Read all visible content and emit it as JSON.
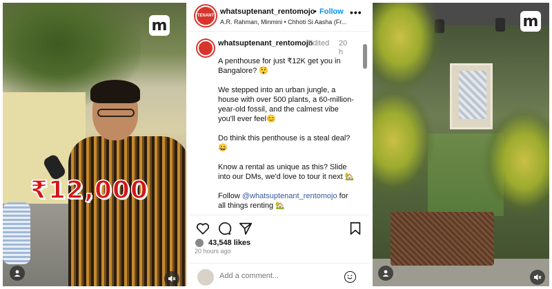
{
  "left_reel": {
    "price_overlay": "₹12,000",
    "logo_letter": "m"
  },
  "post": {
    "header": {
      "username": "whatsuptenant_rentomojo",
      "separator": "•",
      "follow_label": "Follow",
      "audio": "A.R. Rahman, Minmini • Chhoti Si Aasha (Fr...",
      "avatar_text": "TENANT"
    },
    "caption": {
      "username": "whatsuptenant_rentomojo",
      "edited": "Edited",
      "age": "20 h",
      "paragraphs": [
        "A penthouse for just ₹12K get you in Bangalore? 😲",
        "We stepped into an urban jungle, a house with over 500 plants, a 60-million-year-old fossil, and the calmest vibe you'll ever feel😊",
        "Do think this penthouse is a steal deal? 😄"
      ],
      "paragraph_4": "Know a rental as unique as this? Slide into our DMs, we'd love to tour it next 🏡",
      "follow_prefix": "Follow ",
      "follow_handle": "@whatsuptenant_rentomojo",
      "follow_suffix": " for all things renting 🏡"
    },
    "likes": "43,548 likes",
    "time": "20 hours ago",
    "comment_placeholder": "Add a comment..."
  },
  "right_reel": {
    "logo_letter": "m"
  },
  "colors": {
    "accent": "#0095f6",
    "brand": "#d8342c",
    "price": "#d41515"
  }
}
